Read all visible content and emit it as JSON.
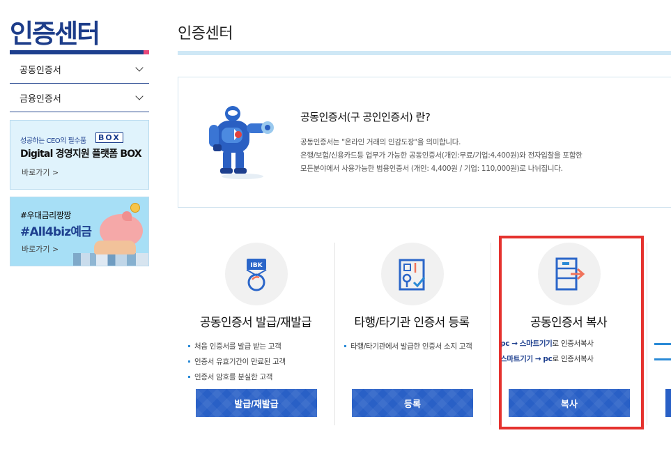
{
  "sidebar": {
    "title": "인증센터",
    "menu": [
      {
        "label": "공동인증서"
      },
      {
        "label": "금융인증서"
      }
    ],
    "banner1": {
      "small": "성공하는 CEO의 필수품",
      "box": "BOX",
      "main": "Digital 경영지원 플랫폼 BOX",
      "link": "바로가기 >"
    },
    "banner2": {
      "small": "#우대금리짱짱",
      "main": "#All4biz예금",
      "link": "바로가기 >"
    }
  },
  "main": {
    "title": "인증센터",
    "info": {
      "heading": "공동인증서(구 공인인증서) 란?",
      "lines": [
        "공동인증서는 \"온라인 거래의 인감도장\"을 의미합니다.",
        "은행/보험/신용카드등 업무가 가능한 공동인증서(개인:무료/기업:4,400원)와 전자입찰을 포함한",
        "모든분야에서 사용가능한 범용인증서 (개인: 4,400원 / 기업: 110,000원)로 나뉘집니다."
      ]
    },
    "cards": [
      {
        "title": "공동인증서 발급/재발급",
        "bullets": [
          "처음 인증서를 발급 받는 고객",
          "인증서 유효기간이 만료된 고객",
          "인증서 암호를 분실한 고객"
        ],
        "button": "발급/재발급"
      },
      {
        "title": "타행/타기관 인증서 등록",
        "bullets": [
          "타행/타기관에서 발급한 인증서 소지 고객"
        ],
        "button": "등록"
      },
      {
        "title": "공동인증서 복사",
        "copy": [
          {
            "from": "pc",
            "arrow": "→",
            "to": "스마트기기",
            "suffix": "로 인증서복사"
          },
          {
            "from": "스마트기기",
            "arrow": "→",
            "to": "pc",
            "suffix": "로 인증서복사"
          }
        ],
        "button": "복사"
      }
    ]
  },
  "colors": {
    "brand": "#1d3f8e",
    "button": "#2960c6",
    "highlight": "#e5322e"
  }
}
